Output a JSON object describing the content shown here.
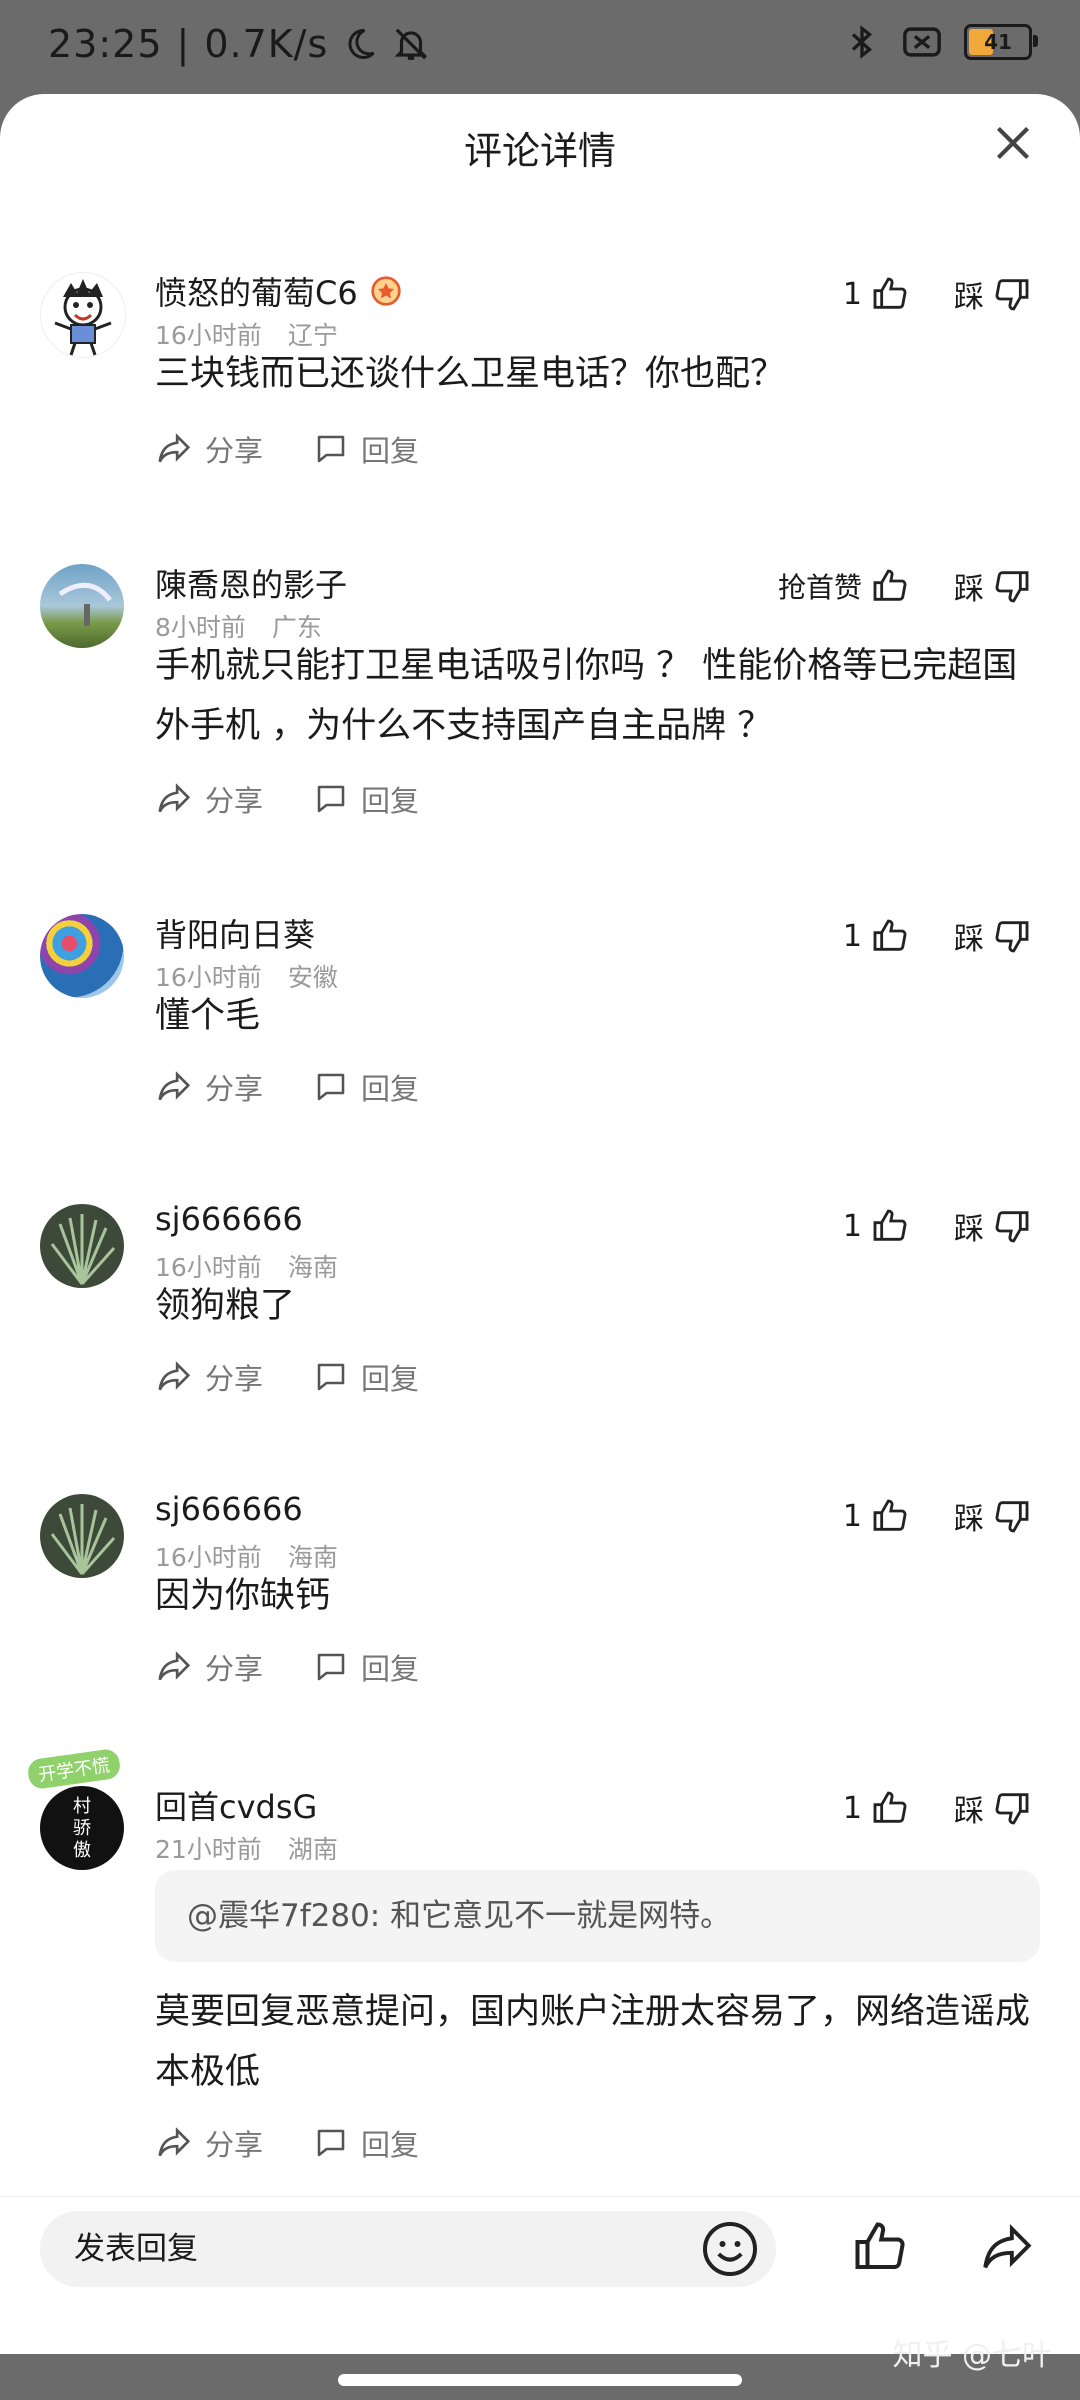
{
  "status_bar": {
    "time": "23:25",
    "speed": "0.7K/s",
    "battery": "41"
  },
  "sheet": {
    "title": "评论详情"
  },
  "labels": {
    "share": "分享",
    "reply": "回复",
    "dislike": "踩"
  },
  "comments": [
    {
      "username": "愤怒的葡萄C6",
      "time": "16小时前",
      "location": "辽宁",
      "likes": "1",
      "text": "三块钱而已还谈什么卫星电话？你也配？"
    },
    {
      "username": "陳喬恩的影子",
      "time": "8小时前",
      "location": "广东",
      "likes": "抢首赞",
      "text": "手机就只能打卫星电话吸引你吗 ？ 性能价格等已完超国外手机 ，为什么不支持国产自主品牌 ？"
    },
    {
      "username": "背阳向日葵",
      "time": "16小时前",
      "location": "安徽",
      "likes": "1",
      "text": "懂个毛"
    },
    {
      "username": "sj666666",
      "time": "16小时前",
      "location": "海南",
      "likes": "1",
      "text": "领狗粮了"
    },
    {
      "username": "sj666666",
      "time": "16小时前",
      "location": "海南",
      "likes": "1",
      "text": "因为你缺钙"
    },
    {
      "username": "回首cvdsG",
      "time": "21小时前",
      "location": "湖南",
      "likes": "1",
      "quote": "@震华7f280: 和它意见不一就是网特。",
      "text": "莫要回复恶意提问，国内账户注册太容易了，网络造谣成本极低",
      "badge": "开学不慌",
      "avatar_text": "村 骄 傲"
    }
  ],
  "bottom_bar": {
    "placeholder": "发表回复"
  },
  "watermark": "知乎 @七叶"
}
